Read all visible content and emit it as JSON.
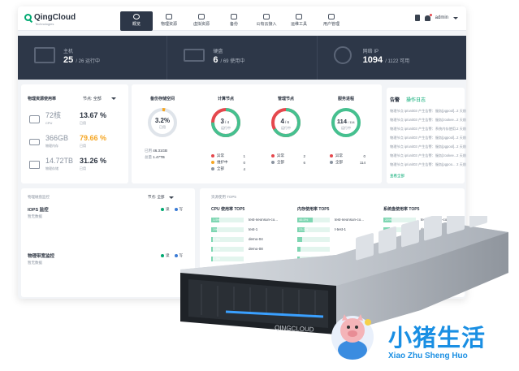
{
  "app": {
    "logo_text": "QingCloud",
    "logo_sub": "Technologies",
    "nav": [
      {
        "label": "概览",
        "icon": "dashboard-icon",
        "active": true
      },
      {
        "label": "物理资源",
        "icon": "server-icon",
        "active": false
      },
      {
        "label": "虚拟资源",
        "icon": "layers-icon",
        "active": false
      },
      {
        "label": "备份",
        "icon": "backup-icon",
        "active": false
      },
      {
        "label": "公有云接入",
        "icon": "cloud-icon",
        "active": false
      },
      {
        "label": "运维工具",
        "icon": "wrench-icon",
        "active": false
      },
      {
        "label": "用户管理",
        "icon": "user-icon",
        "active": false
      }
    ],
    "user": "admin"
  },
  "summary": [
    {
      "label": "主机",
      "value": "25",
      "detail": "/ 26 运行中",
      "icon": "monitor-icon"
    },
    {
      "label": "硬盘",
      "value": "6",
      "detail": "/ 69 使用中",
      "icon": "disk-icon"
    },
    {
      "label": "网络 IP",
      "value": "1094",
      "detail": "/ 1122 可用",
      "icon": "globe-icon"
    }
  ],
  "physical": {
    "title": "物理资源使用率",
    "filter": "节点: 全部",
    "rows": [
      {
        "amount": "72核",
        "unit": "CPU",
        "pct": "13.67 %",
        "pct_label": "已用",
        "color": "#2b3340",
        "icon": "cpu-icon"
      },
      {
        "amount": "366GB",
        "unit": "物理内存",
        "pct": "79.66 %",
        "pct_label": "已用",
        "color": "#f5a623",
        "icon": "memory-icon"
      },
      {
        "amount": "14.72TB",
        "unit": "物理存储",
        "pct": "31.26 %",
        "pct_label": "已用",
        "color": "#2b3340",
        "icon": "storage-icon"
      }
    ]
  },
  "backup": {
    "title": "备份存储空间",
    "pct": "3.2%",
    "pct_label": "已用",
    "used_label": "已用",
    "used": "46.31GB",
    "total_label": "总量",
    "total": "1.47TB",
    "fraction": 0.032
  },
  "compute_nodes": {
    "title": "计算节点",
    "value": "3",
    "total": "/ 4",
    "sub": "运行中",
    "fraction": 0.75,
    "legend": [
      {
        "label": "异常",
        "num": "1",
        "color": "#e5484d"
      },
      {
        "label": "维护中",
        "num": "0",
        "color": "#f5a623"
      },
      {
        "label": "全部",
        "num": "4",
        "color": "#8a93a0"
      }
    ]
  },
  "mgmt_nodes": {
    "title": "管理节点",
    "value": "4",
    "total": "/ 6",
    "sub": "运行中",
    "fraction": 0.667,
    "legend": [
      {
        "label": "异常",
        "num": "2",
        "color": "#e5484d"
      },
      {
        "label": "全部",
        "num": "6",
        "color": "#8a93a0"
      }
    ]
  },
  "services": {
    "title": "服务进程",
    "value": "114",
    "total": "/ 114",
    "sub": "运行中",
    "fraction": 1,
    "legend": [
      {
        "label": "异常",
        "num": "0",
        "color": "#e5484d"
      },
      {
        "label": "全部",
        "num": "114",
        "color": "#8a93a0"
      }
    ]
  },
  "alerts": {
    "tab_active": "告警",
    "tab_other": "操作日志",
    "rows": [
      {
        "text": "物理节点 ip/unit03 产生告警：服务[pgpool]...",
        "time": "2 天前"
      },
      {
        "text": "物理节点 ip/unit03 产生告警：服务[zookee...",
        "time": "2 天前"
      },
      {
        "text": "物理节点 ip/unit03 产生告警：系统内存使用...",
        "time": "2 天前"
      },
      {
        "text": "物理节点 ip/unit03 产生告警：服务[pgpool]...",
        "time": "2 天前"
      },
      {
        "text": "物理节点 ip/unit03 产生告警：服务[pgpool]...",
        "time": "2 天前"
      },
      {
        "text": "物理节点 ip/unit03 产生告警：服务[zookee...",
        "time": "2 天前"
      },
      {
        "text": "物理节点 ip/unit03 产生告警：服务[pgpoo...",
        "time": "2 天前"
      }
    ],
    "more": "查看全部"
  },
  "monitor": {
    "title": "物理磁盘监控",
    "filter": "节点: 全部",
    "iops_title": "IOPS 监控",
    "iops_empty": "暂无数据",
    "bw_title": "物理带宽监控",
    "bw_empty": "暂无数据",
    "legend_read": "读",
    "legend_write": "写"
  },
  "top5": {
    "title": "资源使用 TOP5",
    "columns": [
      {
        "title": "CPU 使用率 TOP5",
        "rows": [
          {
            "pct": "1.5%",
            "fill": 0.25,
            "name": "test-neonsun-co..."
          },
          {
            "pct": "1%",
            "fill": 0.18,
            "name": "test-1"
          },
          {
            "pct": "0.3%",
            "fill": 0.06,
            "name": "demo-04"
          },
          {
            "pct": "0.3%",
            "fill": 0.06,
            "name": "demo-08"
          },
          {
            "pct": "0.3%",
            "fill": 0.06,
            "name": ""
          }
        ]
      },
      {
        "title": "内存使用率 TOP5",
        "rows": [
          {
            "pct": "46.5%",
            "fill": 0.47,
            "name": "test-neonsun-co..."
          },
          {
            "pct": "23.2%",
            "fill": 0.23,
            "name": "t-test-1"
          },
          {
            "pct": "",
            "fill": 0.15,
            "name": ""
          },
          {
            "pct": "",
            "fill": 0.1,
            "name": ""
          },
          {
            "pct": "",
            "fill": 0.08,
            "name": ""
          }
        ]
      },
      {
        "title": "系统盘使用率 TOP5",
        "rows": [
          {
            "pct": "25%",
            "fill": 0.25,
            "name": "test-neonsun-co..."
          },
          {
            "pct": "",
            "fill": 0.2,
            "name": "demo-08"
          },
          {
            "pct": "",
            "fill": 0.15,
            "name": ""
          },
          {
            "pct": "",
            "fill": 0.1,
            "name": ""
          },
          {
            "pct": "",
            "fill": 0.08,
            "name": ""
          }
        ]
      }
    ]
  },
  "server": {
    "brand": "QINGCLOUD"
  },
  "watermark": {
    "cn": "小猪生活",
    "en": "Xiao Zhu Sheng Huo"
  }
}
